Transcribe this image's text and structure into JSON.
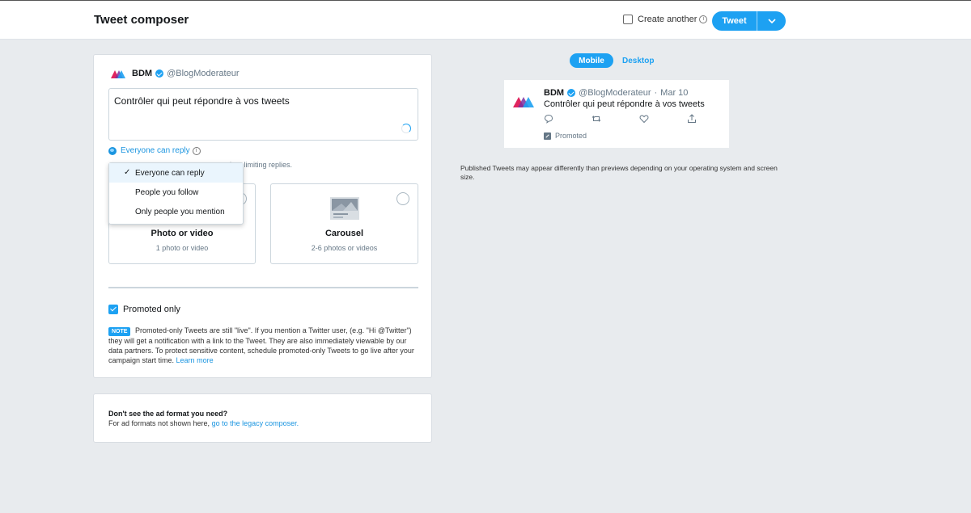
{
  "header": {
    "title": "Tweet composer",
    "create_another_label": "Create another",
    "tweet_button_label": "Tweet"
  },
  "composer": {
    "account_name": "BDM",
    "account_handle": "@BlogModerateur",
    "tweet_text": "Contrôler qui peut répondre à vos tweets",
    "reply_setting_label": "Everyone can reply",
    "hint_text": "hen limiting replies.",
    "reply_options": [
      {
        "label": "Everyone can reply",
        "selected": true
      },
      {
        "label": "People you follow",
        "selected": false
      },
      {
        "label": "Only people you mention",
        "selected": false
      }
    ],
    "formats": [
      {
        "title": "Photo or video",
        "subtitle": "1 photo or video"
      },
      {
        "title": "Carousel",
        "subtitle": "2-6 photos or videos"
      }
    ],
    "promoted_only_label": "Promoted only",
    "promoted_only_checked": true,
    "note_badge": "NOTE",
    "note_text": "Promoted-only Tweets are still \"live\". If you mention a Twitter user, (e.g. \"Hi @Twitter\") they will get a notification with a link to the Tweet. They are also immediately viewable by our data partners. To protect sensitive content, schedule promoted-only Tweets to go live after your campaign start time.",
    "learn_more_label": "Learn more"
  },
  "legacy": {
    "title": "Don't see the ad format you need?",
    "text": "For ad formats not shown here,",
    "link": "go to the legacy composer."
  },
  "preview": {
    "tabs": [
      "Mobile",
      "Desktop"
    ],
    "active_tab": "Mobile",
    "name": "BDM",
    "handle": "@BlogModerateur",
    "separator": "·",
    "date": "Mar 10",
    "text": "Contrôler qui peut répondre à vos tweets",
    "promoted_label": "Promoted",
    "disclaimer": "Published Tweets may appear differently than previews depending on your operating system and screen size."
  },
  "colors": {
    "accent": "#1da1f2",
    "background": "#e8ebee",
    "logo_pink": "#e0245e",
    "logo_blue": "#1da1f2"
  }
}
